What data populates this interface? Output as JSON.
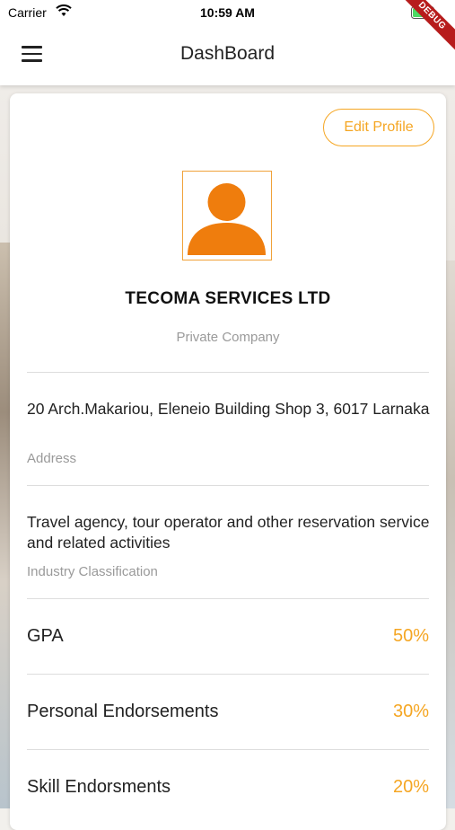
{
  "status_bar": {
    "carrier": "Carrier",
    "time": "10:59 AM",
    "debug_banner": "DEBUG",
    "icons": [
      "wifi-icon",
      "battery-icon"
    ]
  },
  "app_bar": {
    "title": "DashBoard",
    "menu_icon": "hamburger-menu-icon"
  },
  "profile": {
    "edit_button_label": "Edit Profile",
    "avatar_icon": "person-icon",
    "company_name": "TECOMA SERVICES LTD",
    "company_type": "Private Company",
    "address": {
      "value": "20 Arch.Makariou, Eleneio Building Shop 3, 6017 Larnaka",
      "label": "Address"
    },
    "industry": {
      "value": "Travel agency, tour operator and other reservation service and related activities",
      "label": "Industry Classification"
    },
    "stats": [
      {
        "label": "GPA",
        "value": "50%"
      },
      {
        "label": "Personal Endorsements",
        "value": "30%"
      },
      {
        "label": "Skill Endorsments",
        "value": "20%"
      }
    ]
  },
  "colors": {
    "accent": "#f5a623",
    "avatar": "#ef7d0d",
    "debug_ribbon": "#b71c1c"
  }
}
